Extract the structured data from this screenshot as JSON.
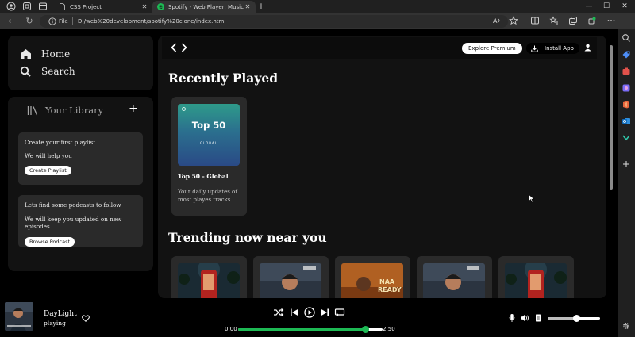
{
  "browser": {
    "tabs": [
      {
        "title": "CSS Project",
        "active": false
      },
      {
        "title": "Spotify - Web Player: Music for e",
        "active": true
      }
    ],
    "new_tab_label": "+",
    "address": {
      "scheme_label": "File",
      "url": "D:/web%20development/spotify%20clone/index.html"
    }
  },
  "sidebar": {
    "nav": [
      {
        "label": "Home",
        "icon": "home-icon"
      },
      {
        "label": "Search",
        "icon": "search-icon"
      }
    ],
    "library": {
      "title": "Your Library",
      "add_label": "+",
      "cards": [
        {
          "heading": "Create your first playlist",
          "text": "We will help you",
          "button": "Create Playlist"
        },
        {
          "heading": "Lets find some podcasts to follow",
          "text": "We will keep you updated on new episodes",
          "button": "Browse Podcast"
        }
      ]
    }
  },
  "header": {
    "explore_label": "Explore Premium",
    "install_label": "Install App"
  },
  "main": {
    "recently_played_title": "Recently Played",
    "recent": [
      {
        "art_title": "Top 50",
        "art_subtitle": "GLOBAL",
        "title": "Top 50 - Global",
        "description": "Your daily updates of most playes tracks"
      }
    ],
    "trending_title": "Trending now near you",
    "trending_count": 5
  },
  "player": {
    "song": "DayLight",
    "status": "playing",
    "time_start": "0:00",
    "time_end": "2:50",
    "progress": 0.88,
    "volume": 0.55
  },
  "colors": {
    "accent": "#1db954",
    "background": "#000000",
    "panel": "#121212",
    "card": "#2a2a2a"
  }
}
